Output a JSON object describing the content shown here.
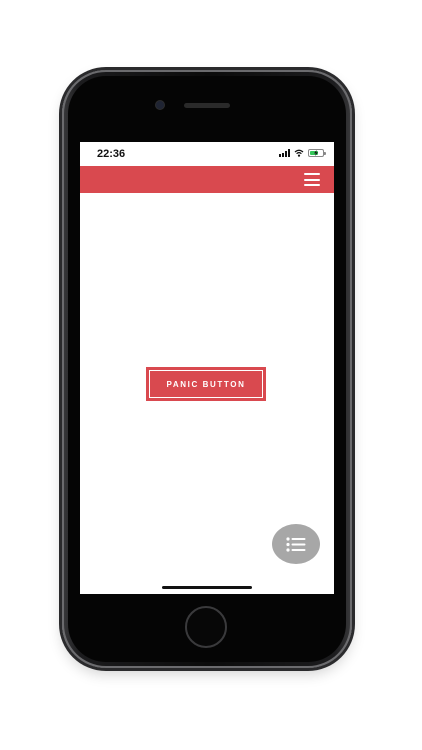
{
  "status_bar": {
    "time": "22:36",
    "battery_level": 0.7,
    "battery_charging": true
  },
  "app_bar": {
    "color": "#d9494f",
    "menu_icon": "hamburger-menu-icon"
  },
  "main": {
    "panic_button_label": "PANIC BUTTON"
  },
  "fab": {
    "icon": "list-icon",
    "color": "#a7a7a7"
  },
  "colors": {
    "accent": "#d9494f"
  }
}
